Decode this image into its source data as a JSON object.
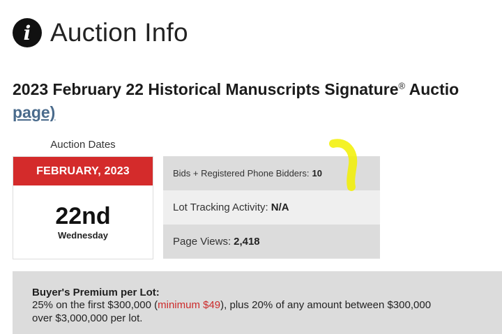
{
  "header": {
    "title": "Auction Info",
    "icon": "info-icon"
  },
  "auction": {
    "title": "2023 February 22 Historical Manuscripts Signature",
    "reg_mark": "®",
    "title_tail": " Auctio",
    "link_text": "page)"
  },
  "dates": {
    "label": "Auction Dates",
    "month": "FEBRUARY, 2023",
    "day": "22nd",
    "weekday": "Wednesday"
  },
  "stats": [
    {
      "label": "Bids + Registered Phone Bidders:",
      "value": "10"
    },
    {
      "label": "Lot Tracking Activity:",
      "value": "N/A"
    },
    {
      "label": "Page Views:",
      "value": "2,418"
    }
  ],
  "premium": {
    "title": "Buyer's Premium per Lot:",
    "line1_start": "25% on the first $300,000 (",
    "line1_min": "minimum $49",
    "line1_end": "), plus 20% of any amount between $300,000",
    "line2": "over $3,000,000 per lot."
  },
  "colors": {
    "month_bar": "#d42b2b",
    "link": "#4a6b8c",
    "highlight": "#f2f000",
    "minimum": "#cc2b2b"
  }
}
